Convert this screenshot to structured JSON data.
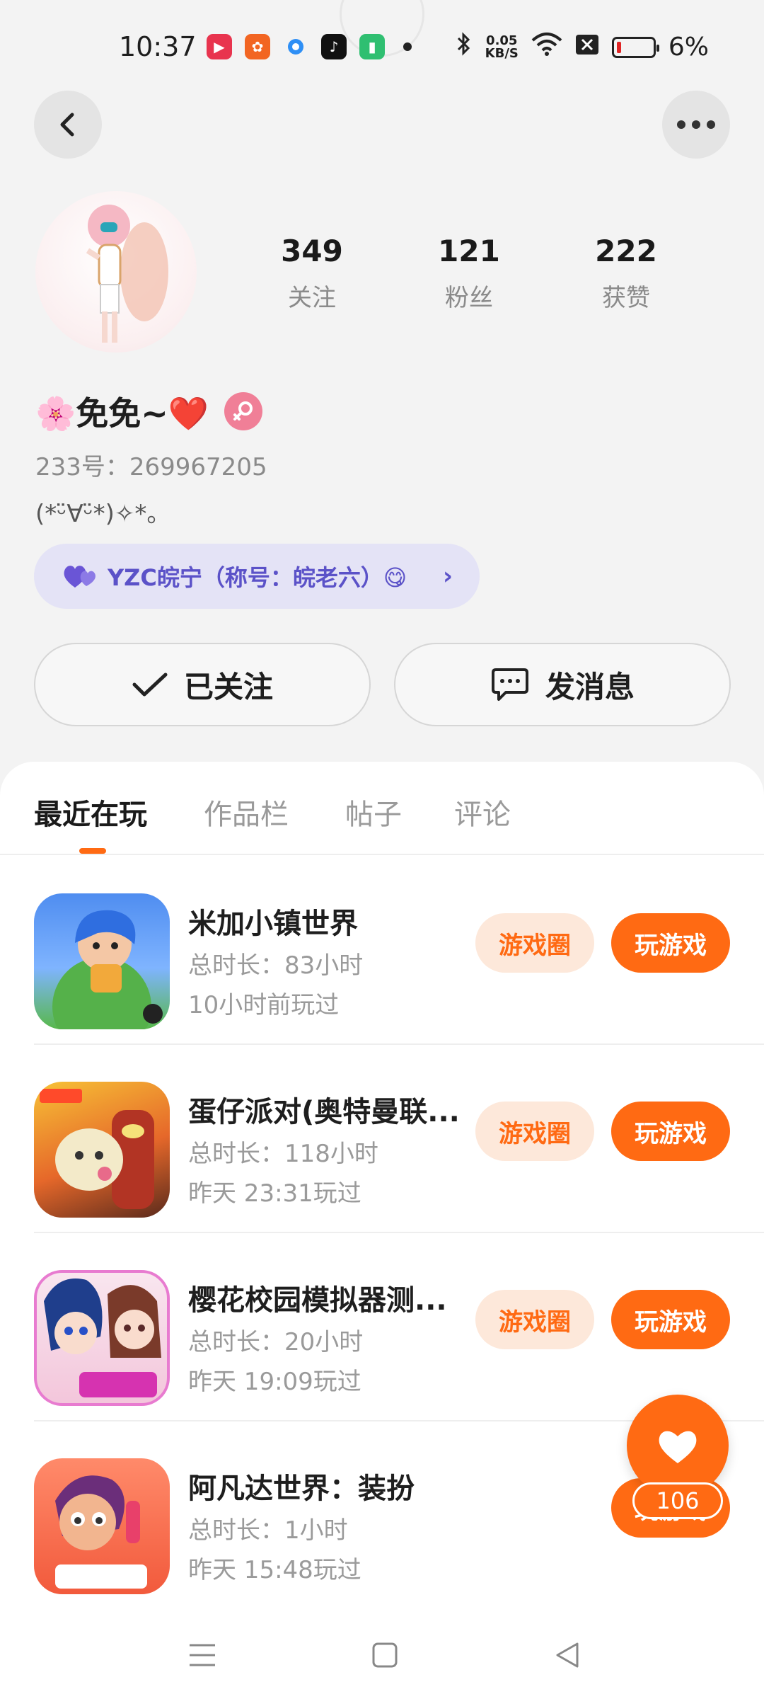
{
  "status_bar": {
    "time": "10:37",
    "net_speed_value": "0.05",
    "net_speed_unit": "KB/S",
    "battery": "6%"
  },
  "profile": {
    "stats": [
      {
        "value": "349",
        "label": "关注"
      },
      {
        "value": "121",
        "label": "粉丝"
      },
      {
        "value": "222",
        "label": "获赞"
      }
    ],
    "nickname": "🌸免免~❤️",
    "uid": "233号：269967205",
    "bio": "(*ᵕ̈∀ᵕ̈*)✧*。",
    "title_pill": "YZC皖宁（称号：皖老六）😋",
    "follow_label": "已关注",
    "message_label": "发消息"
  },
  "tabs": [
    "最近在玩",
    "作品栏",
    "帖子",
    "评论"
  ],
  "games": [
    {
      "name": "米加小镇世界",
      "time": "总时长：83小时",
      "last": "10小时前玩过",
      "circle": "游戏圈",
      "play": "玩游戏"
    },
    {
      "name": "蛋仔派对(奥特曼联...",
      "time": "总时长：118小时",
      "last": "昨天 23:31玩过",
      "circle": "游戏圈",
      "play": "玩游戏"
    },
    {
      "name": "樱花校园模拟器测...",
      "time": "总时长：20小时",
      "last": "昨天 19:09玩过",
      "circle": "游戏圈",
      "play": "玩游戏"
    },
    {
      "name": "阿凡达世界：装扮",
      "time": "总时长：1小时",
      "last": "昨天 15:48玩过",
      "play": "玩游戏"
    }
  ],
  "fab": {
    "count": "106"
  },
  "colors": {
    "accent": "#ff6a13",
    "accent_light": "#fde8da",
    "pill_bg": "#e4e3f6",
    "pill_text": "#5b52c8"
  }
}
